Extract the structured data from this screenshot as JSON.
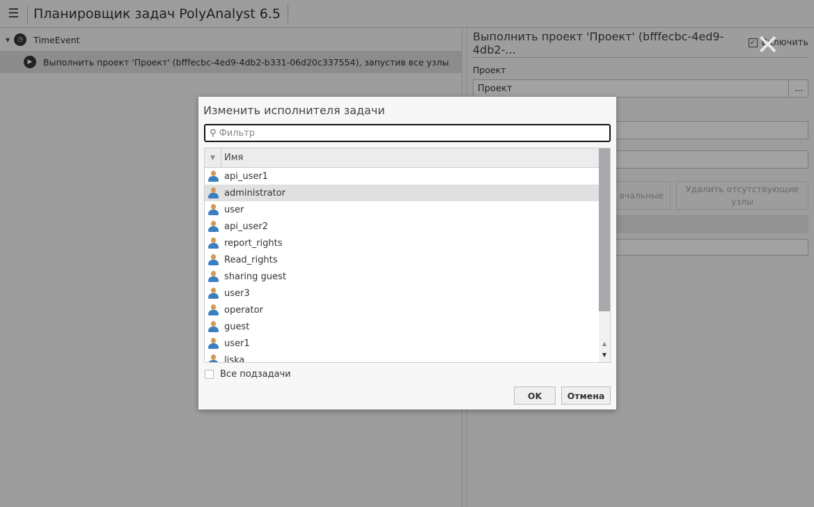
{
  "app": {
    "title": "Планировщик задач PolyAnalyst 6.5",
    "menu_icon": "hamburger-icon"
  },
  "tree": {
    "items": [
      {
        "label": "TimeEvent",
        "icon": "clock-icon"
      },
      {
        "label": "Выполнить проект 'Проект' (bfffecbc-4ed9-4db2-b331-06d20c337554), запустив все узлы",
        "icon": "play-icon"
      }
    ]
  },
  "details": {
    "title": "Выполнить проект 'Проект' (bfffecbc-4ed9-4db2-...",
    "enable_label": "Включить",
    "enabled": true,
    "project_label": "Проект",
    "project_value": "Проект",
    "browse_label": "...",
    "btn_initial_partial": "ачальные",
    "btn_remove_missing": "Удалить отсутствующие узлы"
  },
  "dialog": {
    "title": "Изменить исполнителя задачи",
    "filter_placeholder": "Фильтр",
    "column_name": "Имя",
    "users": [
      "api_user1",
      "administrator",
      "user",
      "api_user2",
      "report_rights",
      "Read_rights",
      "sharing guest",
      "user3",
      "operator",
      "guest",
      "user1",
      "liska"
    ],
    "highlighted": "administrator",
    "all_subtasks_label": "Все подзадачи",
    "all_subtasks_checked": false,
    "ok_label": "OK",
    "cancel_label": "Отмена"
  }
}
